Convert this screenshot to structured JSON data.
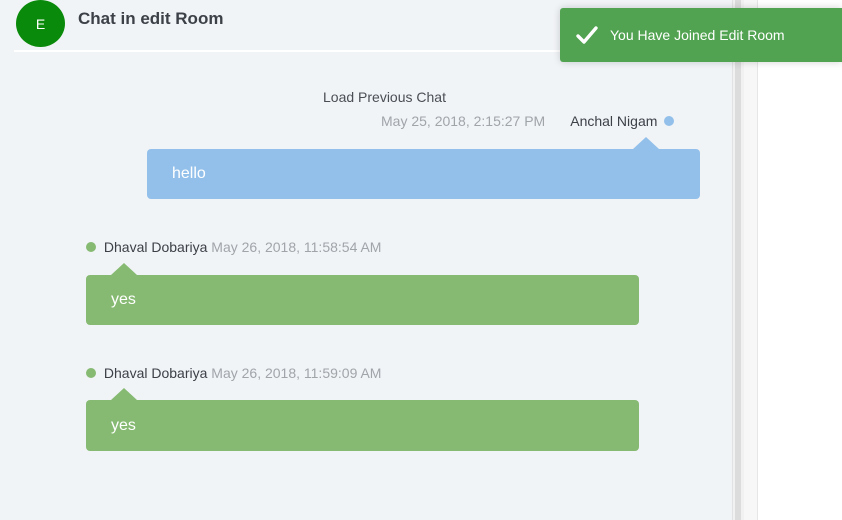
{
  "header": {
    "avatar_letter": "E",
    "title": "Chat in edit Room"
  },
  "chat": {
    "load_previous": "Load Previous Chat",
    "messages": [
      {
        "sender": "Anchal Nigam",
        "time": "May 25, 2018, 2:15:27 PM",
        "text": "hello",
        "side": "right",
        "color": "#93c0ea"
      },
      {
        "sender": "Dhaval Dobariya",
        "time": "May 26, 2018, 11:58:54 AM",
        "text": "yes",
        "side": "left",
        "color": "#86ba72"
      },
      {
        "sender": "Dhaval Dobariya",
        "time": "May 26, 2018, 11:59:09 AM",
        "text": "yes",
        "side": "left",
        "color": "#86ba72"
      }
    ]
  },
  "toast": {
    "icon": "checkmark-icon",
    "text": "You Have Joined Edit Room",
    "color": "#51a351"
  }
}
